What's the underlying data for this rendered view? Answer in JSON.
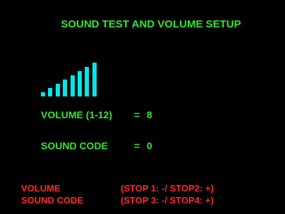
{
  "title": "SOUND TEST AND VOLUME SETUP",
  "volume": {
    "label": "VOLUME (1-12)",
    "equals": "=",
    "value": "8",
    "level": 8,
    "max": 12
  },
  "sound_code": {
    "label": "SOUND CODE",
    "equals": "=",
    "value": "0"
  },
  "controls": [
    {
      "name": "VOLUME",
      "keys": "(STOP 1: -/ STOP2: +)"
    },
    {
      "name": "SOUND CODE",
      "keys": "(STOP 3: -/ STOP4: +)"
    }
  ],
  "colors": {
    "background": "#000000",
    "text": "#33e633",
    "meter": "#00e8e8",
    "controls": "#ff2a2a"
  }
}
